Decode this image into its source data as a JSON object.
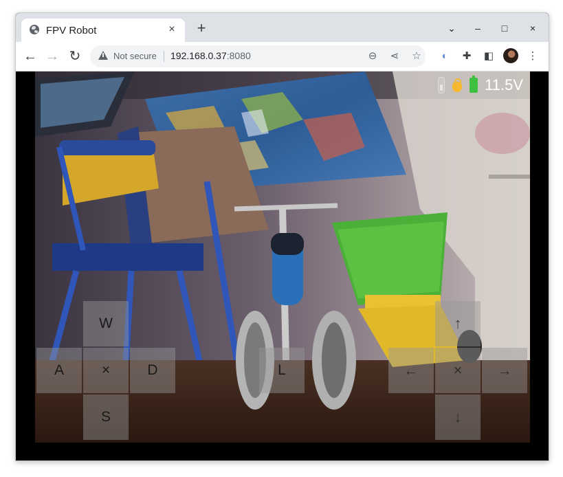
{
  "browser": {
    "tab_title": "FPV Robot",
    "tab_close": "×",
    "new_tab": "+",
    "window_controls": {
      "dropdown": "⌄",
      "minimize": "–",
      "maximize": "□",
      "close": "×"
    },
    "nav": {
      "back": "←",
      "forward": "→",
      "reload": "↻"
    },
    "security_label": "Not secure",
    "url_host": "192.168.0.37",
    "url_port": ":8080",
    "icons": [
      "zoom-out-icon",
      "share-icon",
      "bookmark-star-icon",
      "opera-extension-icon",
      "puzzle-extensions-icon",
      "side-panel-icon",
      "profile-avatar",
      "kebab-menu-icon"
    ]
  },
  "status": {
    "voltage": "11.5V",
    "icons": [
      "thermometer-icon",
      "ok-hand-icon",
      "battery-icon"
    ],
    "colors": {
      "battery": "#3fbf3f",
      "ok_hand": "#f5b82e"
    }
  },
  "wasd_pad": {
    "up": "W",
    "left": "A",
    "center": "×",
    "right": "D",
    "down": "S"
  },
  "middle_pad": {
    "label": "L"
  },
  "arrow_pad": {
    "up": "↑",
    "left": "←",
    "center": "×",
    "right": "→",
    "down": "↓"
  }
}
